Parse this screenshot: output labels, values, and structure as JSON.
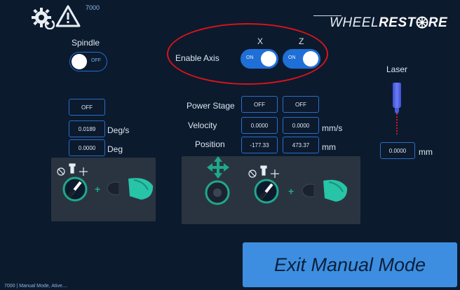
{
  "header": {
    "icons": [
      "gear-refresh-icon",
      "warning-icon"
    ],
    "code": "7000",
    "brand_thin": "WHEEL",
    "brand_bold": "REST",
    "brand_end": "RE"
  },
  "spindle": {
    "label": "Spindle",
    "toggle_state": "OFF"
  },
  "enable_axis": {
    "label": "Enable Axis",
    "x_label": "X",
    "z_label": "Z",
    "x_state": "ON",
    "z_state": "ON",
    "highlight_color": "#d8141a"
  },
  "spindle_controls": {
    "power_button": "OFF",
    "velocity_value": "0.0189",
    "velocity_unit": "Deg/s",
    "position_value": "0.0000",
    "position_unit": "Deg"
  },
  "axis_controls": {
    "power_stage_label": "Power Stage",
    "velocity_label": "Velocity",
    "position_label": "Position",
    "x_power": "OFF",
    "z_power": "OFF",
    "x_velocity": "0.0000",
    "z_velocity": "0.0000",
    "velocity_unit": "mm/s",
    "x_position": "-177.33",
    "z_position": "473.37",
    "position_unit": "mm"
  },
  "laser": {
    "label": "Laser",
    "value": "0.0000",
    "unit": "mm"
  },
  "exit_button": "Exit Manual Mode",
  "status_bar": "7000 | Manual Mode, Ative....",
  "colors": {
    "background": "#0c1a2e",
    "accent": "#1f6fd6",
    "button": "#3d8ee0",
    "teal": "#1fa88a"
  }
}
